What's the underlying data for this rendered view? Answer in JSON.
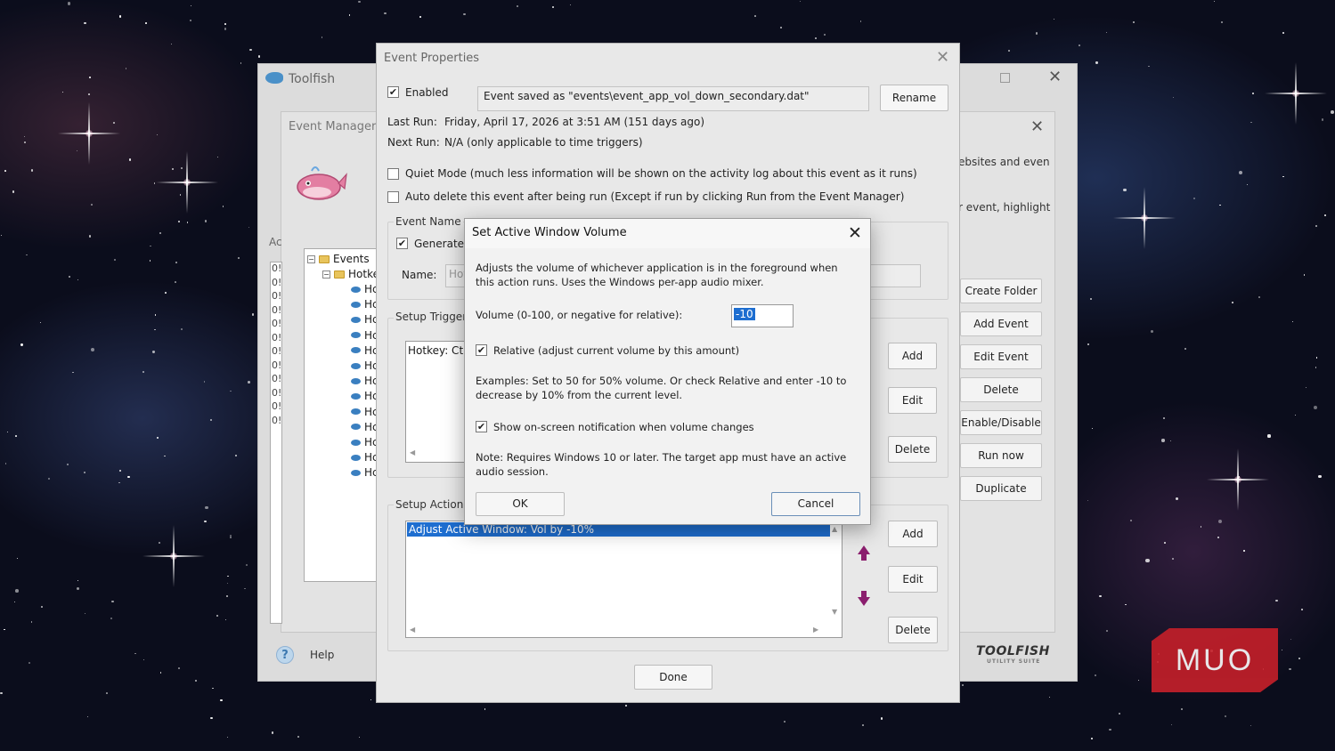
{
  "toolfish": {
    "title": "Toolfish",
    "help_label": "Help",
    "brand": "TOOLFISH",
    "brand_sub": "UTILITY SUITE"
  },
  "event_manager": {
    "title": "Event Manager",
    "ac_fragment": "Ac",
    "right_text_1": "ebsites and even",
    "right_text_2": "r event, highlight",
    "tree": {
      "root": "Events",
      "folder": "Hotke",
      "item_prefix": "Ho",
      "item_short": "Hc",
      "item_count": 13
    },
    "codes_fragment": "0!",
    "buttons": {
      "create_folder": "Create Folder",
      "add_event": "Add Event",
      "edit_event": "Edit Event",
      "delete": "Delete",
      "enable_disable": "Enable/Disable",
      "run_now": "Run now",
      "duplicate": "Duplicate"
    }
  },
  "event_properties": {
    "title": "Event Properties",
    "enabled_label": "Enabled",
    "enabled_checked": true,
    "saved_as": "Event saved as \"events\\event_app_vol_down_secondary.dat\"",
    "rename_button": "Rename",
    "last_run_label": "Last Run:",
    "last_run_value": "Friday, April 17, 2026 at  3:51 AM (151 days ago)",
    "next_run_label": "Next Run:",
    "next_run_value": "N/A (only applicable to time triggers)",
    "quiet_mode": "Quiet Mode (much less information will be shown on the activity log about this event as it runs)",
    "auto_delete": "Auto delete this event after being run (Except if run by clicking Run from the Event Manager)",
    "event_name_group": "Event Name",
    "generate_label": "Generate",
    "generate_checked": true,
    "name_label": "Name:",
    "name_value_fragment": "Hot",
    "setup_trigger_group": "Setup Trigger",
    "trigger_item": "Hotkey: Ctrl",
    "trigger_buttons": {
      "add": "Add",
      "edit": "Edit",
      "delete": "Delete"
    },
    "setup_action_group": "Setup Action (",
    "action_item": "Adjust Active Window: Vol by -10%",
    "action_buttons": {
      "add": "Add",
      "edit": "Edit",
      "delete": "Delete"
    },
    "done_button": "Done"
  },
  "volume_dialog": {
    "title": "Set Active Window Volume",
    "description": "Adjusts the volume of whichever application is in the foreground when this action runs. Uses the Windows per-app audio mixer.",
    "volume_label": "Volume (0-100, or negative for relative):",
    "volume_value": "-10",
    "relative_label": "Relative (adjust current volume by this amount)",
    "relative_checked": true,
    "examples": "Examples: Set to 50 for 50% volume. Or check Relative and enter -10 to decrease by 10% from the current level.",
    "notify_label": "Show on-screen notification when volume changes",
    "notify_checked": true,
    "note": "Note: Requires Windows 10 or later. The target app must have an active audio session.",
    "ok_button": "OK",
    "cancel_button": "Cancel"
  },
  "watermark": {
    "text": "MUO",
    "color": "#c6202a"
  },
  "colors": {
    "selection": "#1e6ed0",
    "arrow": "#8b1e6e",
    "dialog_bg": "#e8e8e8"
  }
}
